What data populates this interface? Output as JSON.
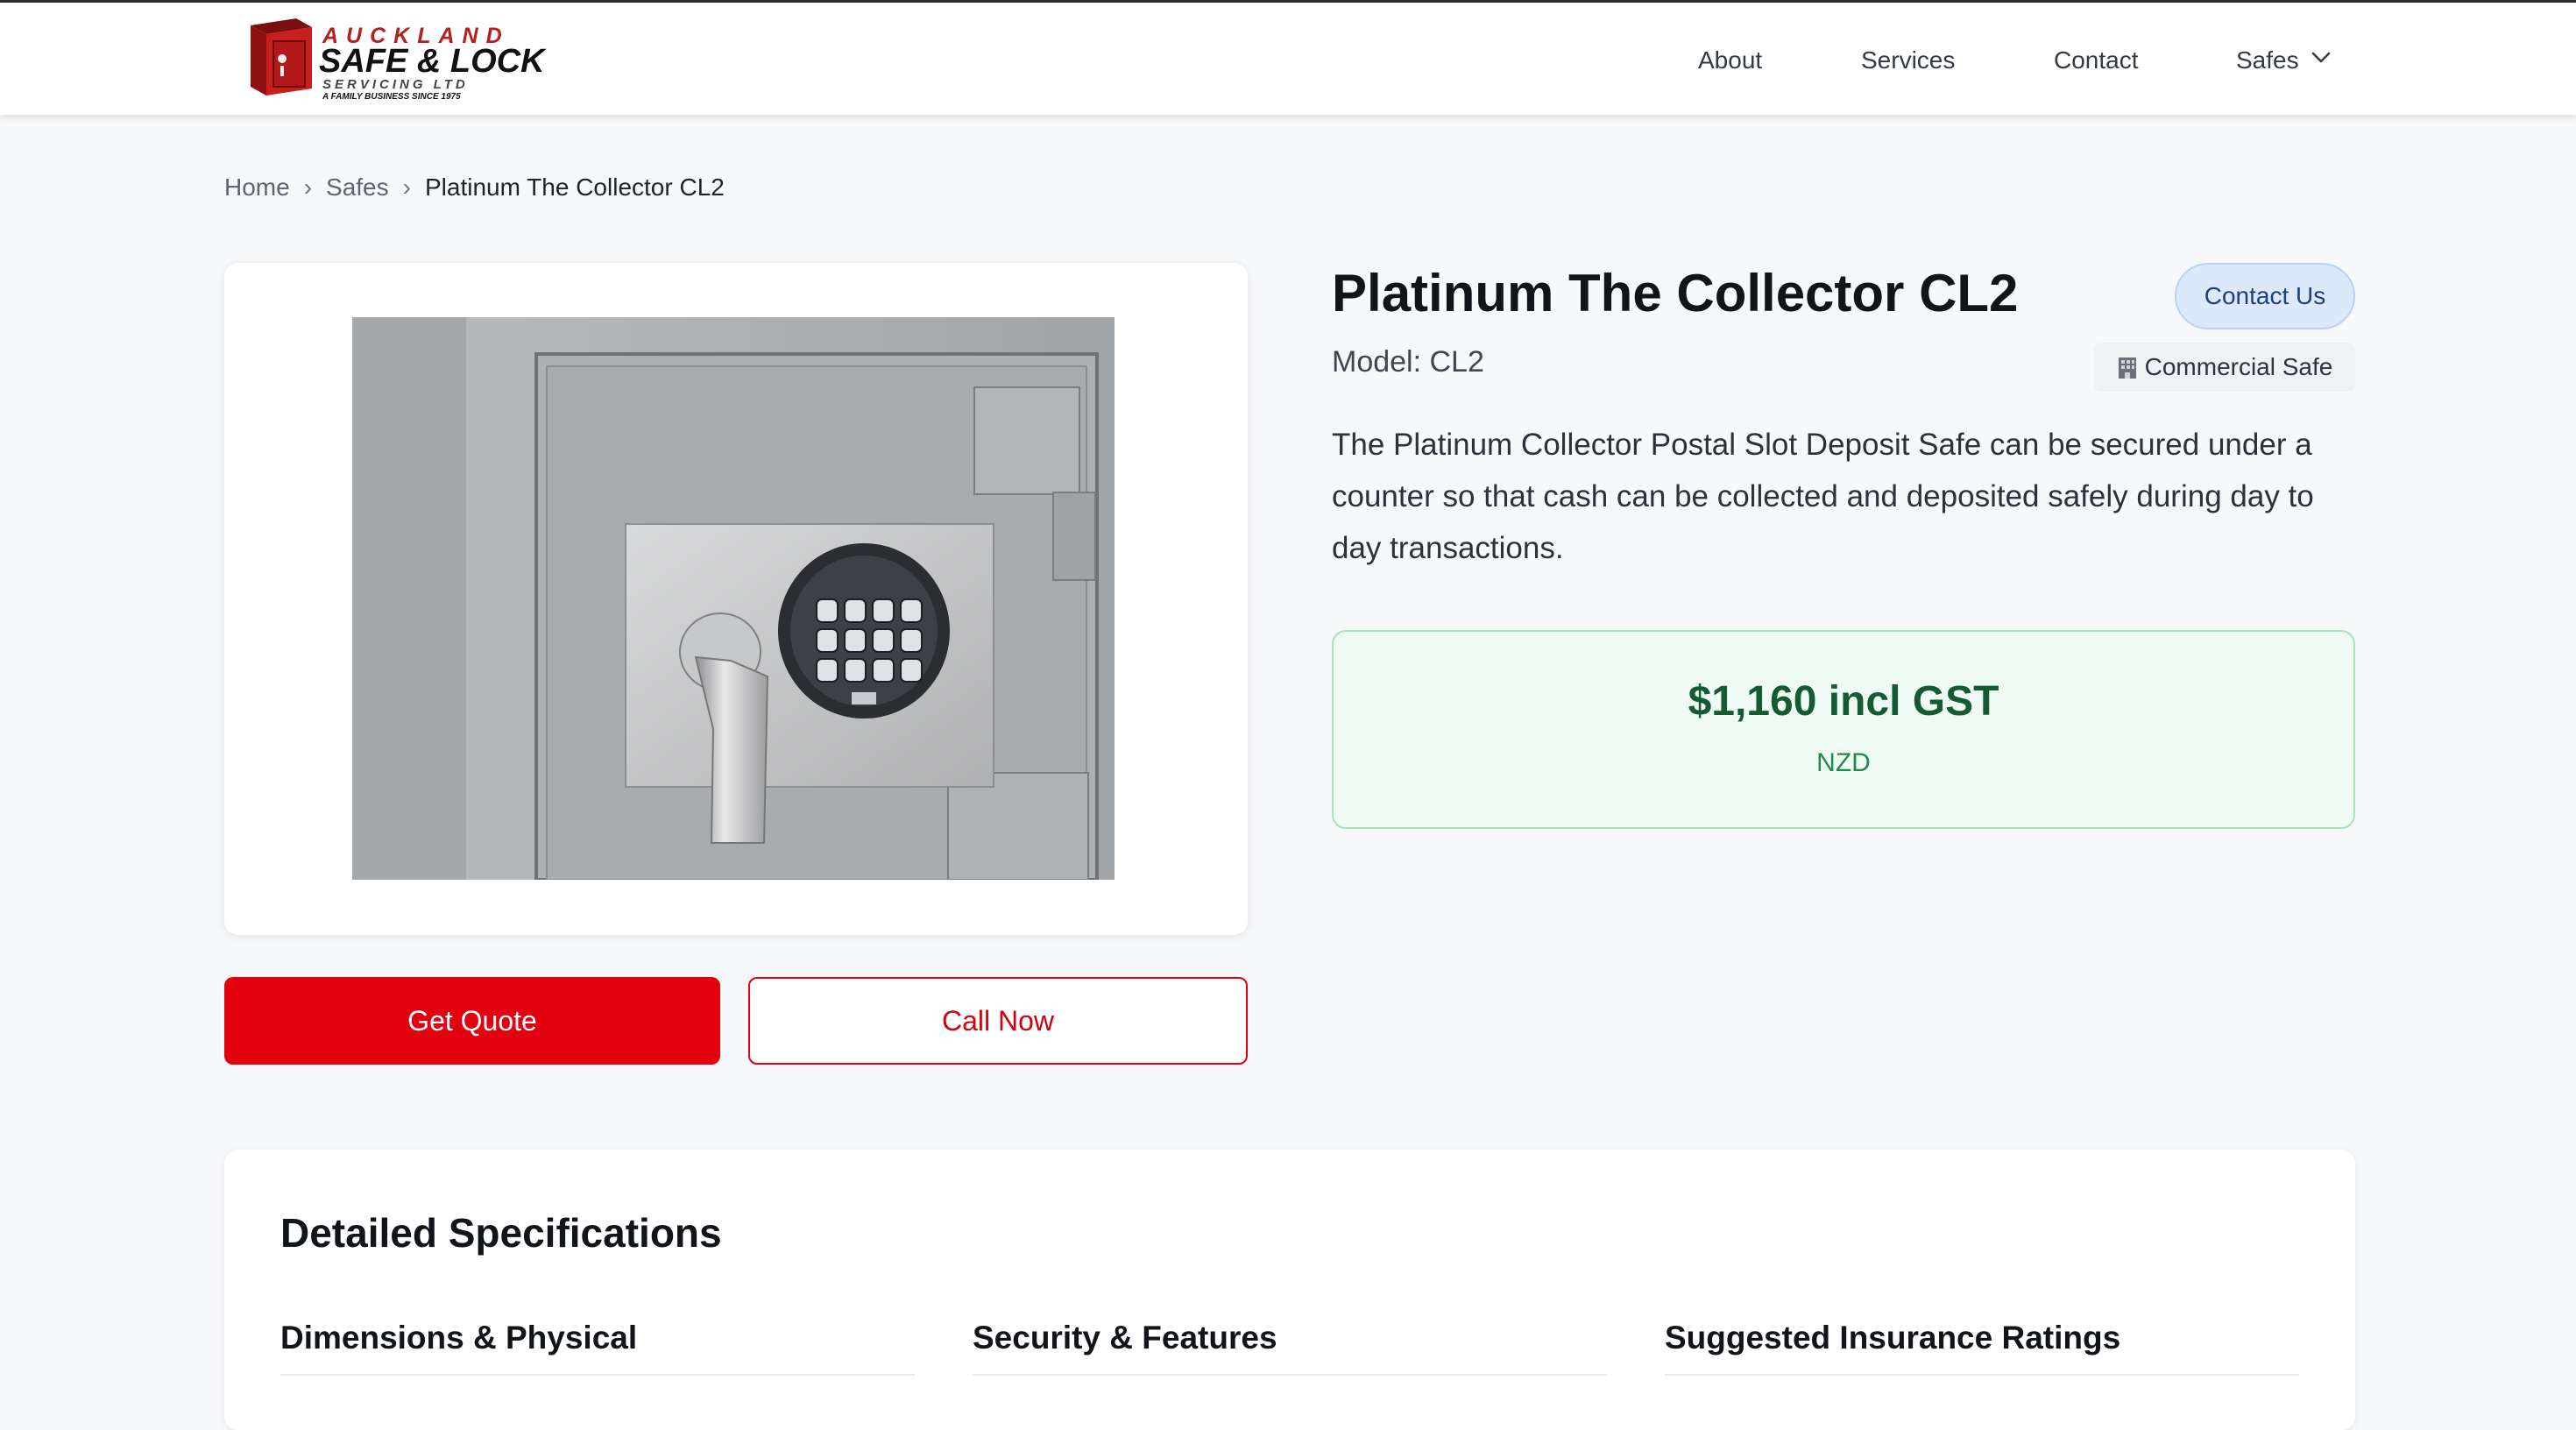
{
  "header": {
    "logo": {
      "line1": "AUCKLAND",
      "line2": "SAFE & LOCK",
      "line3": "SERVICING LTD",
      "line4": "A FAMILY BUSINESS SINCE 1975"
    },
    "nav": [
      {
        "label": "About"
      },
      {
        "label": "Services"
      },
      {
        "label": "Contact"
      },
      {
        "label": "Safes",
        "icon": "chevron-down-icon"
      }
    ]
  },
  "breadcrumb": {
    "items": [
      "Home",
      "Safes",
      "Platinum The Collector CL2"
    ],
    "separator": "›"
  },
  "product": {
    "title": "Platinum The Collector CL2",
    "model": "Model: CL2",
    "contact_label": "Contact Us",
    "type_badge": "Commercial Safe",
    "type_badge_icon": "building-icon",
    "description": "The Platinum Collector Postal Slot Deposit Safe can be secured under a counter so that cash can be collected and deposited safely during day to day transactions.",
    "price": "$1,160 incl GST",
    "currency": "NZD",
    "image_alt_icon": "safe-image"
  },
  "actions": {
    "quote_label": "Get Quote",
    "call_label": "Call Now"
  },
  "specs": {
    "title": "Detailed Specifications",
    "columns": [
      {
        "title": "Dimensions & Physical"
      },
      {
        "title": "Security & Features"
      },
      {
        "title": "Suggested Insurance Ratings"
      }
    ]
  },
  "colors": {
    "brand_red": "#e3000f",
    "price_green": "#145a32",
    "price_bg": "#effbf2",
    "pill_blue": "#dbe9fb"
  }
}
